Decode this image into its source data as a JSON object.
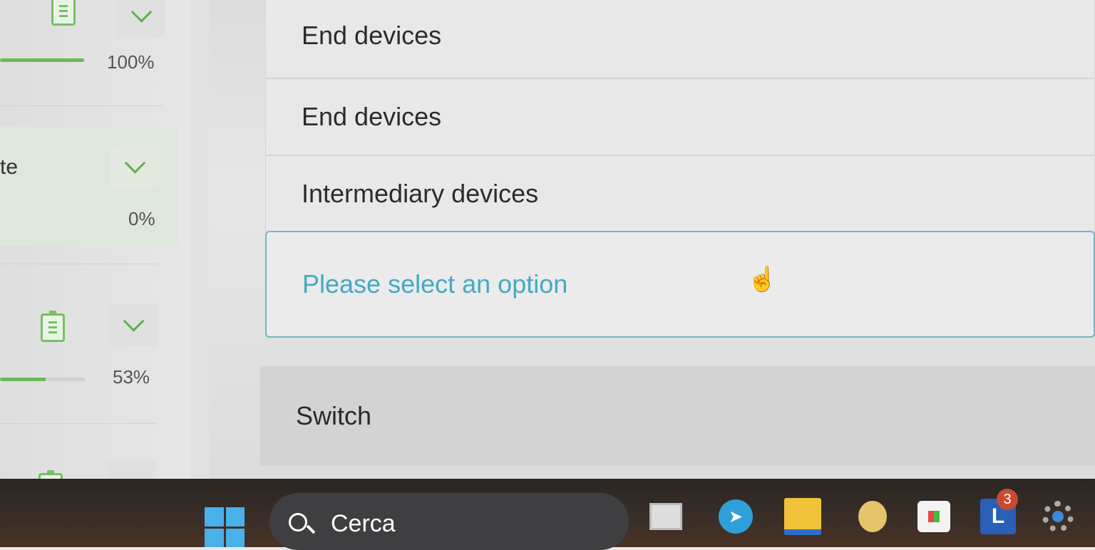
{
  "sidebar": {
    "items": [
      {
        "progress_label": "100%",
        "progress": 1.0
      },
      {
        "title": "te",
        "progress_label": "0%",
        "progress": 0.0
      },
      {
        "progress_label": "53%",
        "progress": 0.53
      }
    ]
  },
  "question": {
    "options": [
      {
        "label": "End devices"
      },
      {
        "label": "End devices"
      },
      {
        "label": "Intermediary devices"
      }
    ],
    "select_placeholder": "Please select an option",
    "answer_label": "Switch"
  },
  "taskbar": {
    "search_label": "Cerca",
    "notification_count": "3",
    "icons": [
      "start-icon",
      "task-view-icon",
      "telegram-icon",
      "file-explorer-icon",
      "game-icon",
      "store-icon",
      "app-l-icon",
      "settings-icon"
    ]
  },
  "colors": {
    "accent_green": "#6aba58",
    "accent_cyan": "#43a9c6",
    "taskbar": "#2f2a26"
  }
}
